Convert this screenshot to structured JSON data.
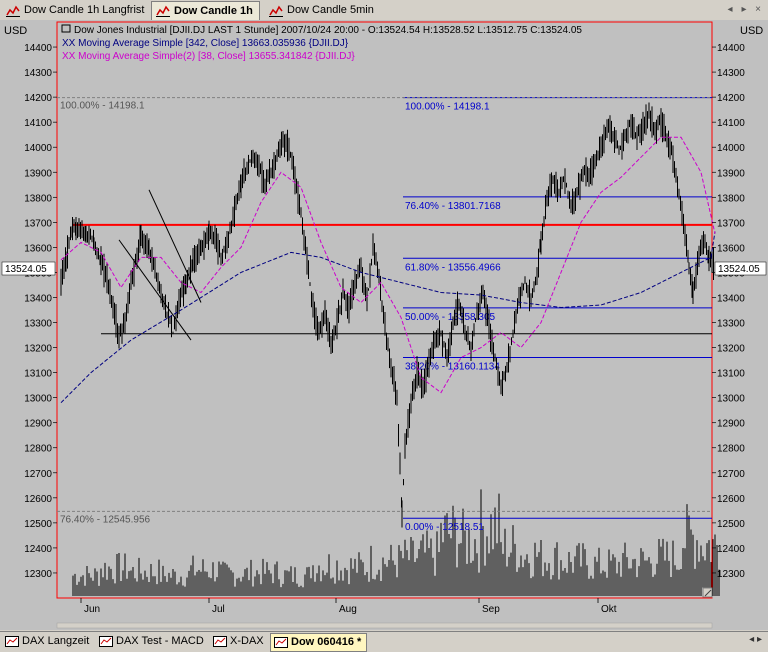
{
  "top_tabs": [
    {
      "label": "Dow Candle 1h Langfrist",
      "active": false
    },
    {
      "label": "Dow Candle 1h",
      "active": true
    },
    {
      "label": "Dow Candle 5min",
      "active": false
    }
  ],
  "window_controls": {
    "prev": "◂",
    "next": "▸",
    "close": "×"
  },
  "header": {
    "title": "Dow Jones Industrial [DJII.DJ LAST 1 Stunde] 2007/10/24 20:00 - O:13524.54 H:13528.52 L:13512.75 C:13524.05",
    "ma1": "XX Moving Average Simple [342, Close] 13663.035936 {DJII.DJ}",
    "ma2": "XX Moving Average Simple(2) [38, Close] 13655.341842 {DJII.DJ}"
  },
  "axis_unit": "USD",
  "current_price_label": "13524.05",
  "chart_data": {
    "type": "candlestick",
    "ylim": [
      12200,
      14500
    ],
    "y_ticks": [
      12300,
      12400,
      12500,
      12600,
      12700,
      12800,
      12900,
      13000,
      13100,
      13200,
      13300,
      13400,
      13500,
      13600,
      13700,
      13800,
      13900,
      14000,
      14100,
      14200,
      14300,
      14400
    ],
    "x_labels": [
      "Jun",
      "Jul",
      "Aug",
      "Sep",
      "Okt"
    ],
    "close_path": [
      [
        0,
        13460
      ],
      [
        5,
        13560
      ],
      [
        8,
        13600
      ],
      [
        10,
        13660
      ],
      [
        15,
        13680
      ],
      [
        25,
        13660
      ],
      [
        33,
        13620
      ],
      [
        40,
        13540
      ],
      [
        46,
        13480
      ],
      [
        52,
        13360
      ],
      [
        58,
        13240
      ],
      [
        64,
        13300
      ],
      [
        70,
        13460
      ],
      [
        76,
        13560
      ],
      [
        80,
        13640
      ],
      [
        88,
        13600
      ],
      [
        94,
        13500
      ],
      [
        100,
        13420
      ],
      [
        106,
        13340
      ],
      [
        112,
        13260
      ],
      [
        118,
        13380
      ],
      [
        125,
        13460
      ],
      [
        132,
        13540
      ],
      [
        140,
        13600
      ],
      [
        148,
        13660
      ],
      [
        154,
        13640
      ],
      [
        160,
        13560
      ],
      [
        166,
        13620
      ],
      [
        172,
        13720
      ],
      [
        180,
        13860
      ],
      [
        186,
        13920
      ],
      [
        192,
        13960
      ],
      [
        198,
        13920
      ],
      [
        204,
        13860
      ],
      [
        210,
        13900
      ],
      [
        216,
        13960
      ],
      [
        222,
        14020
      ],
      [
        228,
        14000
      ],
      [
        234,
        13880
      ],
      [
        240,
        13720
      ],
      [
        246,
        13560
      ],
      [
        252,
        13360
      ],
      [
        258,
        13260
      ],
      [
        264,
        13340
      ],
      [
        270,
        13200
      ],
      [
        276,
        13300
      ],
      [
        282,
        13420
      ],
      [
        288,
        13360
      ],
      [
        294,
        13460
      ],
      [
        300,
        13520
      ],
      [
        306,
        13380
      ],
      [
        312,
        13600
      ],
      [
        318,
        13480
      ],
      [
        324,
        13280
      ],
      [
        330,
        13120
      ],
      [
        336,
        13000
      ],
      [
        341,
        12540
      ],
      [
        344,
        12800
      ],
      [
        350,
        12980
      ],
      [
        356,
        13100
      ],
      [
        362,
        13040
      ],
      [
        368,
        13140
      ],
      [
        374,
        13220
      ],
      [
        380,
        13260
      ],
      [
        386,
        13160
      ],
      [
        392,
        13300
      ],
      [
        398,
        13380
      ],
      [
        404,
        13260
      ],
      [
        410,
        13200
      ],
      [
        416,
        13340
      ],
      [
        422,
        13420
      ],
      [
        428,
        13280
      ],
      [
        434,
        13160
      ],
      [
        440,
        13040
      ],
      [
        446,
        13120
      ],
      [
        452,
        13260
      ],
      [
        458,
        13400
      ],
      [
        464,
        13460
      ],
      [
        470,
        13380
      ],
      [
        476,
        13500
      ],
      [
        480,
        13620
      ],
      [
        486,
        13800
      ],
      [
        492,
        13880
      ],
      [
        498,
        13820
      ],
      [
        504,
        13880
      ],
      [
        510,
        13760
      ],
      [
        516,
        13820
      ],
      [
        522,
        13900
      ],
      [
        528,
        13880
      ],
      [
        534,
        13940
      ],
      [
        540,
        14000
      ],
      [
        546,
        14080
      ],
      [
        552,
        14060
      ],
      [
        558,
        13980
      ],
      [
        564,
        14040
      ],
      [
        570,
        14100
      ],
      [
        576,
        14040
      ],
      [
        582,
        14080
      ],
      [
        588,
        14140
      ],
      [
        594,
        14060
      ],
      [
        600,
        14100
      ],
      [
        606,
        14040
      ],
      [
        612,
        13960
      ],
      [
        618,
        13820
      ],
      [
        624,
        13660
      ],
      [
        628,
        13520
      ],
      [
        632,
        13420
      ],
      [
        638,
        13580
      ],
      [
        644,
        13620
      ],
      [
        648,
        13560
      ],
      [
        654,
        13524
      ]
    ],
    "ma342_path": [
      [
        0,
        12980
      ],
      [
        30,
        13100
      ],
      [
        70,
        13230
      ],
      [
        120,
        13350
      ],
      [
        180,
        13500
      ],
      [
        230,
        13580
      ],
      [
        260,
        13560
      ],
      [
        300,
        13500
      ],
      [
        340,
        13460
      ],
      [
        380,
        13420
      ],
      [
        420,
        13410
      ],
      [
        460,
        13380
      ],
      [
        500,
        13360
      ],
      [
        540,
        13370
      ],
      [
        580,
        13420
      ],
      [
        620,
        13500
      ],
      [
        650,
        13560
      ],
      [
        654,
        13663
      ]
    ],
    "ma38_path": [
      [
        0,
        13550
      ],
      [
        20,
        13620
      ],
      [
        40,
        13580
      ],
      [
        60,
        13440
      ],
      [
        80,
        13560
      ],
      [
        100,
        13560
      ],
      [
        120,
        13460
      ],
      [
        140,
        13420
      ],
      [
        160,
        13520
      ],
      [
        180,
        13600
      ],
      [
        200,
        13780
      ],
      [
        220,
        13900
      ],
      [
        240,
        13840
      ],
      [
        260,
        13620
      ],
      [
        280,
        13440
      ],
      [
        300,
        13380
      ],
      [
        320,
        13460
      ],
      [
        340,
        13320
      ],
      [
        360,
        13080
      ],
      [
        380,
        13020
      ],
      [
        400,
        13160
      ],
      [
        420,
        13200
      ],
      [
        440,
        13260
      ],
      [
        460,
        13200
      ],
      [
        480,
        13300
      ],
      [
        500,
        13500
      ],
      [
        520,
        13700
      ],
      [
        540,
        13820
      ],
      [
        560,
        13880
      ],
      [
        580,
        13960
      ],
      [
        600,
        14040
      ],
      [
        620,
        14040
      ],
      [
        640,
        13900
      ],
      [
        654,
        13655
      ]
    ],
    "volume": [
      {
        "x": 12,
        "v": 0.3
      },
      {
        "x": 40,
        "v": 0.4
      },
      {
        "x": 70,
        "v": 0.35
      },
      {
        "x": 100,
        "v": 0.3
      },
      {
        "x": 130,
        "v": 0.38
      },
      {
        "x": 160,
        "v": 0.32
      },
      {
        "x": 190,
        "v": 0.34
      },
      {
        "x": 220,
        "v": 0.3
      },
      {
        "x": 250,
        "v": 0.45
      },
      {
        "x": 280,
        "v": 0.42
      },
      {
        "x": 310,
        "v": 0.5
      },
      {
        "x": 340,
        "v": 0.55
      },
      {
        "x": 360,
        "v": 0.6
      },
      {
        "x": 380,
        "v": 0.9
      },
      {
        "x": 400,
        "v": 0.8
      },
      {
        "x": 420,
        "v": 1.0
      },
      {
        "x": 440,
        "v": 0.7
      },
      {
        "x": 460,
        "v": 0.6
      },
      {
        "x": 480,
        "v": 0.55
      },
      {
        "x": 500,
        "v": 0.5
      },
      {
        "x": 530,
        "v": 0.45
      },
      {
        "x": 560,
        "v": 0.5
      },
      {
        "x": 590,
        "v": 0.55
      },
      {
        "x": 620,
        "v": 0.85
      },
      {
        "x": 640,
        "v": 0.75
      }
    ],
    "resistance_line": {
      "price": 13690,
      "color": "#ff0000"
    },
    "support_line": {
      "price": 13255,
      "color": "#000000"
    },
    "left_fib_labels": [
      {
        "text": "100.00% - 14198.1",
        "price": 14198.1
      },
      {
        "text": "76.40% - 12545.956",
        "price": 12545.956
      }
    ],
    "fibonacci": {
      "color": "#0000cc",
      "levels": [
        {
          "text": "100.00% - 14198.1",
          "price": 14198.1
        },
        {
          "text": "76.40% - 13801.7168",
          "price": 13801.7168
        },
        {
          "text": "61.80% - 13556.4966",
          "price": 13556.4966
        },
        {
          "text": "50.00% - 13358.305",
          "price": 13358.305
        },
        {
          "text": "38.20% - 13160.1134",
          "price": 13160.1134
        },
        {
          "text": "0.00% - 12518.51",
          "price": 12518.51
        }
      ]
    },
    "trend_lines_color": "#000000"
  },
  "bottom_tabs": [
    {
      "label": "DAX Langzeit",
      "active": false
    },
    {
      "label": "DAX Test - MACD",
      "active": false
    },
    {
      "label": "X-DAX",
      "active": false
    },
    {
      "label": "Dow 060416 *",
      "active": true
    }
  ],
  "bottom_nav": "◂ ▸"
}
